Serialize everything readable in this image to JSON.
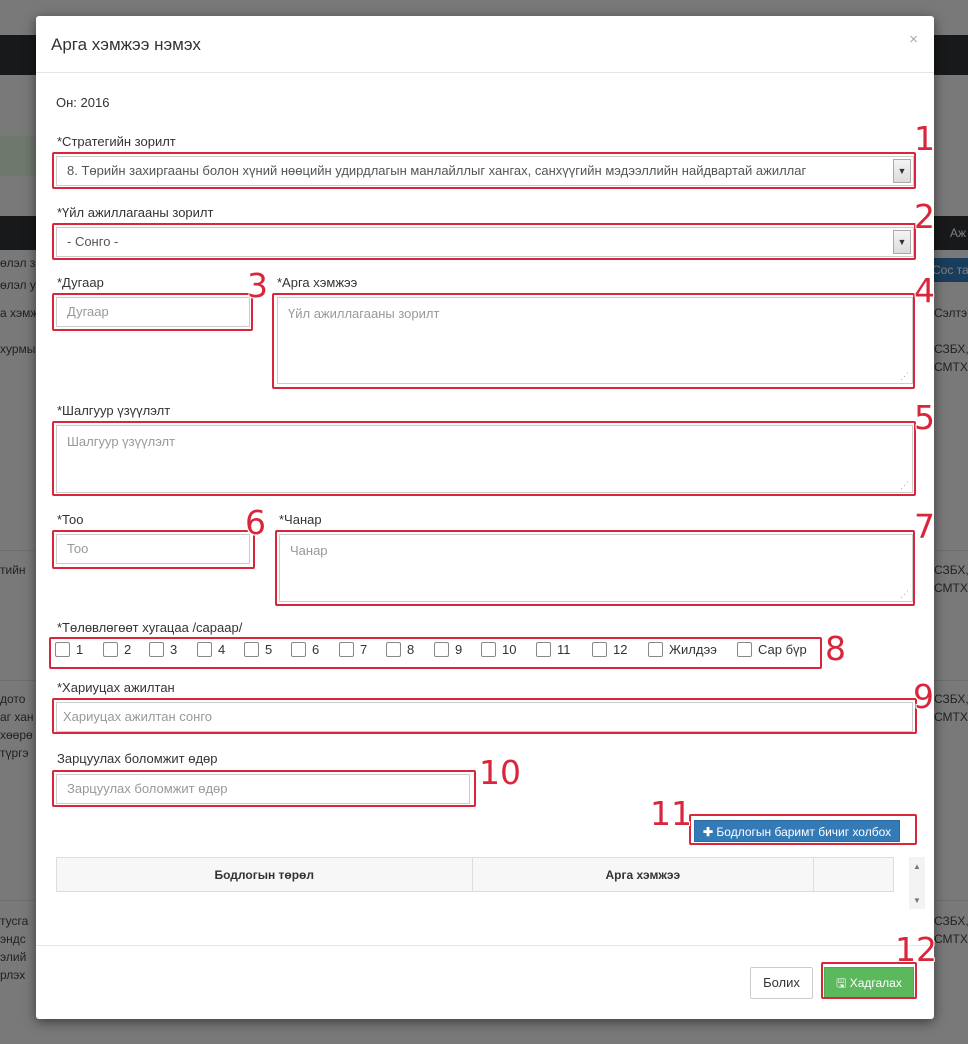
{
  "modal": {
    "title": "Арга хэмжээ нэмэх",
    "close_glyph": "×",
    "year_text": "Он: 2016"
  },
  "fields": {
    "strategic_goal": {
      "label": "*Стратегийн зорилт",
      "value": "8. Төрийн захиргааны болон хүний нөөцийн удирдлагын манлайллыг хангах, санхүүгийн мэдээллийн найдвартай ажиллаг"
    },
    "activity_goal": {
      "label": "*Үйл ажиллагааны зорилт",
      "value": "- Сонго -"
    },
    "number": {
      "label": "*Дугаар",
      "placeholder": "Дугаар"
    },
    "action": {
      "label": "*Арга хэмжээ",
      "placeholder": "Үйл ажиллагааны зорилт"
    },
    "criteria": {
      "label": "*Шалгуур үзүүлэлт",
      "placeholder": "Шалгуур үзүүлэлт"
    },
    "quantity": {
      "label": "*Тоо",
      "placeholder": "Тоо"
    },
    "quality": {
      "label": "*Чанар",
      "placeholder": "Чанар"
    },
    "schedule": {
      "label": "*Төлөвлөгөөт хугацаа /сараар/",
      "options": [
        "1",
        "2",
        "3",
        "4",
        "5",
        "6",
        "7",
        "8",
        "9",
        "10",
        "11",
        "12",
        "Жилдээ",
        "Сар бүр"
      ]
    },
    "responsible": {
      "label": "*Хариуцах ажилтан",
      "placeholder": "Хариуцах ажилтан сонго"
    },
    "spend_date": {
      "label": "Зарцуулах боломжит өдөр",
      "placeholder": "Зарцуулах боломжит өдөр"
    }
  },
  "link_button": {
    "icon": "plus-icon",
    "label": "Бодлогын баримт бичиг холбох"
  },
  "table": {
    "headers": [
      "Бодлогын төрөл",
      "Арга хэмжээ",
      ""
    ]
  },
  "footer": {
    "cancel_label": "Болих",
    "save_label": "Хадгалах",
    "save_icon": "floppy-disk-icon"
  },
  "annotations": [
    "1",
    "2",
    "3",
    "4",
    "5",
    "6",
    "7",
    "8",
    "9",
    "10",
    "11",
    "12"
  ],
  "colors": {
    "annotation_red": "#d9263b",
    "primary_blue": "#337ab7",
    "success_green": "#5cb85c"
  },
  "background_page": {
    "fragments": [
      "Аж",
      "өлэл з",
      "өлэл у",
      "а хэмж",
      "хурмы",
      "Сос тат",
      "Сэлтэ",
      "СЗБХ,",
      "СМТХ",
      "тийн",
      "дото",
      "аг хан",
      "хөөрө",
      "түргэ",
      "тусга",
      "эндс",
      "элий",
      "рлэх"
    ]
  }
}
